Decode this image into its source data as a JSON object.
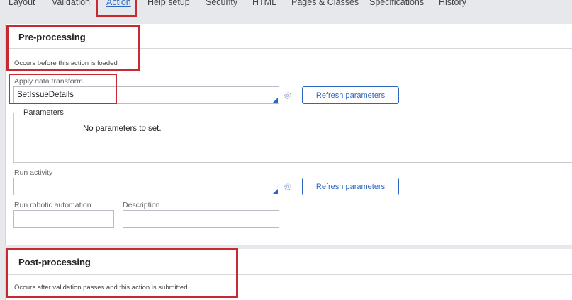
{
  "tabs": [
    {
      "label": "Layout",
      "active": false
    },
    {
      "label": "Validation",
      "active": false
    },
    {
      "label": "Action",
      "active": true
    },
    {
      "label": "Help setup",
      "active": false
    },
    {
      "label": "Security",
      "active": false
    },
    {
      "label": "HTML",
      "active": false
    },
    {
      "label": "Pages & Classes",
      "active": false
    },
    {
      "label": "Specifications",
      "active": false
    },
    {
      "label": "History",
      "active": false
    }
  ],
  "pre_processing": {
    "title": "Pre-processing",
    "subtitle": "Occurs before this action is loaded",
    "apply_data_transform": {
      "label": "Apply data transform",
      "value": "SetIssueDetails"
    },
    "refresh_button_label": "Refresh parameters",
    "parameters": {
      "legend": "Parameters",
      "message": "No parameters to set."
    },
    "run_activity": {
      "label": "Run activity",
      "value": ""
    },
    "refresh_button2_label": "Refresh parameters",
    "run_robotic_automation": {
      "label": "Run robotic automation",
      "value": ""
    },
    "description": {
      "label": "Description",
      "value": ""
    }
  },
  "post_processing": {
    "title": "Post-processing",
    "subtitle": "Occurs after validation passes and this action is submitted"
  },
  "colors": {
    "accent": "#2b66c3",
    "highlight": "#c62a33"
  }
}
